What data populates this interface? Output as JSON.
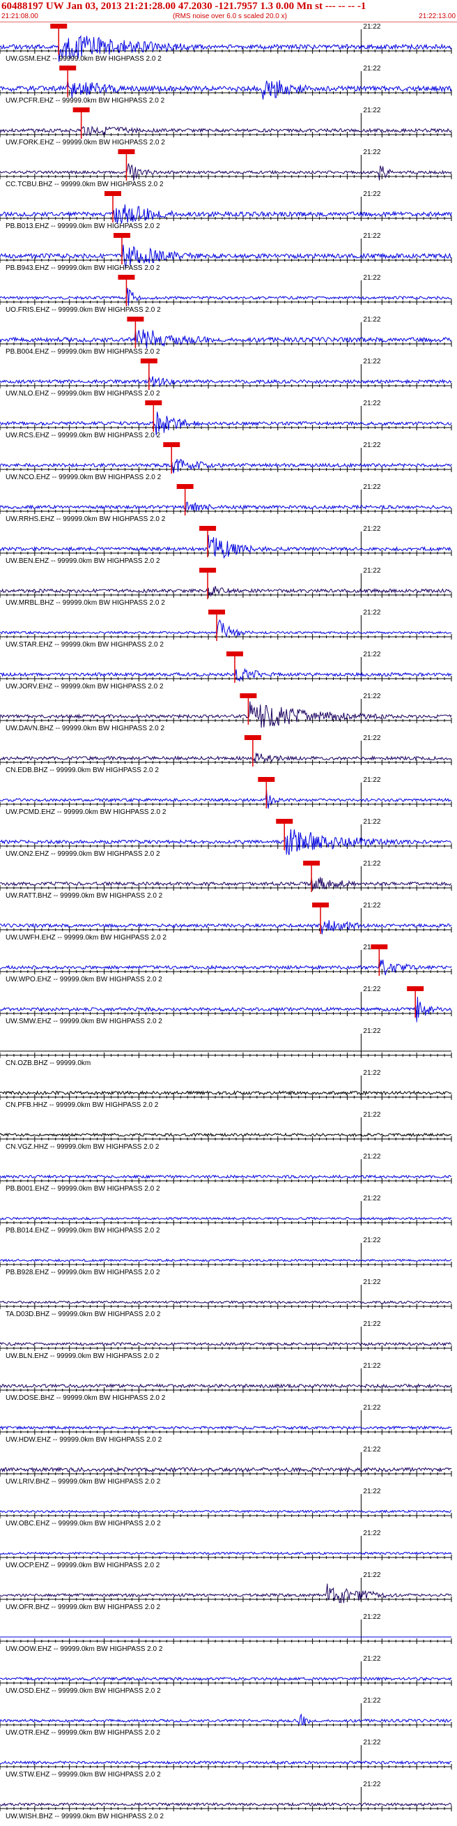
{
  "header": {
    "title": "60488197 UW Jan 03, 2013 21:21:28.00   47.2030 -121.7957  1.3 0.00 Mn st --- -- --  -1",
    "start_time": "21:21:08.00",
    "rms_note": "(RMS noise over 6.0 s scaled 20.0 x)",
    "end_time": "21:22:13.00"
  },
  "colors": {
    "header_red": "#d00000",
    "pick_red": "#e00000",
    "trace_blue": "#0000e0",
    "trace_navy": "#1a0060",
    "trace_black": "#000000",
    "axis_black": "#000000"
  },
  "chart_data": {
    "type": "seismogram",
    "x_axis": {
      "start": "21:21:08.00",
      "end": "21:22:13.00",
      "minute_tick_label": "21:22",
      "minute_tick_time": "21:22:00"
    },
    "traces": [
      {
        "label": "UW.GSM.EHZ -- 99999.0km BW  HIGHPASS  2.0  2",
        "pick_label": "",
        "pick": 0.13,
        "events": [
          [
            0.13,
            0.55,
            1.0
          ]
        ],
        "amp": 0.8,
        "seed": 1,
        "color": "blue"
      },
      {
        "label": "UW.PCFR.EHZ -- 99999.0km BW  HIGHPASS  2.0  2",
        "pick_label": "",
        "pick": 0.15,
        "events": [
          [
            0.15,
            0.3,
            0.7
          ],
          [
            0.58,
            0.2,
            1.0
          ]
        ],
        "amp": 0.9,
        "seed": 2,
        "color": "blue"
      },
      {
        "label": "UW.FORK.EHZ -- 99999.0km BW  HIGHPASS  2.0  2",
        "pick_label": "",
        "pick": 0.18,
        "events": [
          [
            0.18,
            0.4,
            0.4
          ]
        ],
        "amp": 0.6,
        "seed": 3,
        "color": "navy"
      },
      {
        "label": "CC.TCBU.BHZ -- 99999.0km BW  HIGHPASS  2.0  2",
        "pick_label": "",
        "pick": 0.28,
        "events": [
          [
            0.28,
            0.1,
            0.9
          ],
          [
            0.84,
            0.05,
            0.8
          ]
        ],
        "amp": 0.5,
        "seed": 4,
        "color": "navy"
      },
      {
        "label": "PB.B013.EHZ -- 99999.0km BW  HIGHPASS  2.0  2",
        "pick_label": "",
        "pick": 0.25,
        "events": [
          [
            0.25,
            0.3,
            0.9
          ]
        ],
        "amp": 0.8,
        "seed": 5,
        "color": "blue"
      },
      {
        "label": "PB.B943.EHZ -- 99999.0km BW  HIGHPASS  2.0  2",
        "pick_label": "",
        "pick": 0.27,
        "events": [
          [
            0.27,
            0.3,
            0.9
          ]
        ],
        "amp": 0.8,
        "seed": 6,
        "color": "blue"
      },
      {
        "label": "UO.FRIS.EHZ -- 99999.0km BW  HIGHPASS  2.0  2",
        "pick_label": "",
        "pick": 0.28,
        "events": [
          [
            0.28,
            0.05,
            0.9
          ]
        ],
        "amp": 0.5,
        "seed": 7,
        "color": "blue"
      },
      {
        "label": "PB.B004.EHZ -- 99999.0km BW  HIGHPASS  2.0  2",
        "pick_label": "",
        "pick": 0.3,
        "events": [
          [
            0.3,
            0.3,
            0.9
          ]
        ],
        "amp": 0.8,
        "seed": 8,
        "color": "blue"
      },
      {
        "label": "UW.NLO.EHZ -- 99999.0km BW  HIGHPASS  2.0  2",
        "pick_label": "",
        "pick": 0.33,
        "events": [
          [
            0.33,
            0.2,
            0.4
          ]
        ],
        "amp": 0.6,
        "seed": 9,
        "color": "blue"
      },
      {
        "label": "UW.RCS.EHZ -- 99999.0km BW  HIGHPASS  2.0  2",
        "pick_label": "",
        "pick": 0.34,
        "events": [
          [
            0.34,
            0.15,
            1.0
          ]
        ],
        "amp": 0.6,
        "seed": 10,
        "color": "blue"
      },
      {
        "label": "UW.NCO.EHZ -- 99999.0km BW  HIGHPASS  2.0  2",
        "pick_label": "",
        "pick": 0.38,
        "events": [
          [
            0.38,
            0.2,
            0.6
          ]
        ],
        "amp": 0.6,
        "seed": 11,
        "color": "blue"
      },
      {
        "label": "UW.RRHS.EHZ -- 99999.0km BW  HIGHPASS  2.0  2",
        "pick_label": "",
        "pick": 0.41,
        "events": [
          [
            0.41,
            0.2,
            0.4
          ]
        ],
        "amp": 0.6,
        "seed": 12,
        "color": "blue"
      },
      {
        "label": "UW.BEN.EHZ -- 99999.0km BW  HIGHPASS  2.0  2",
        "pick_label": "",
        "pick": 0.46,
        "events": [
          [
            0.46,
            0.2,
            1.0
          ]
        ],
        "amp": 0.6,
        "seed": 13,
        "color": "blue"
      },
      {
        "label": "UW.MRBL.BHZ -- 99999.0km BW  HIGHPASS  2.0  2",
        "pick_label": "",
        "pick": 0.46,
        "events": [
          [
            0.46,
            0.2,
            0.4
          ]
        ],
        "amp": 0.6,
        "seed": 14,
        "color": "navy"
      },
      {
        "label": "UW.STAR.EHZ -- 99999.0km BW  HIGHPASS  2.0  2",
        "pick_label": "",
        "pick": 0.48,
        "events": [
          [
            0.48,
            0.1,
            1.0
          ]
        ],
        "amp": 0.4,
        "seed": 15,
        "color": "blue"
      },
      {
        "label": "UW.JORV.EHZ -- 99999.0km BW  HIGHPASS  2.0  2",
        "pick_label": "",
        "pick": 0.52,
        "events": [
          [
            0.52,
            0.2,
            0.5
          ]
        ],
        "amp": 0.6,
        "seed": 16,
        "color": "blue"
      },
      {
        "label": "UW.DAVN.BHZ -- 99999.0km BW  HIGHPASS  2.0  2",
        "pick_label": "",
        "pick": 0.55,
        "events": [
          [
            0.55,
            0.45,
            1.0
          ]
        ],
        "amp": 0.6,
        "seed": 17,
        "color": "navy"
      },
      {
        "label": "CN.EDB.BHZ -- 99999.0km BW  HIGHPASS  2.0  2",
        "pick_label": "",
        "pick": 0.56,
        "events": [
          [
            0.56,
            0.2,
            0.4
          ]
        ],
        "amp": 0.6,
        "seed": 18,
        "color": "navy"
      },
      {
        "label": "UW.PCMD.EHZ -- 99999.0km BW  HIGHPASS  2.0  2",
        "pick_label": "",
        "pick": 0.59,
        "events": [
          [
            0.59,
            0.05,
            0.8
          ]
        ],
        "amp": 0.5,
        "seed": 19,
        "color": "blue"
      },
      {
        "label": "UW.ON2.EHZ -- 99999.0km BW  HIGHPASS  2.0  2",
        "pick_label": "",
        "pick": 0.63,
        "events": [
          [
            0.63,
            0.4,
            1.0
          ]
        ],
        "amp": 0.6,
        "seed": 20,
        "color": "blue"
      },
      {
        "label": "UW.RATT.BHZ -- 99999.0km BW  HIGHPASS  2.0  2",
        "pick_label": "",
        "pick": 0.69,
        "events": [
          [
            0.69,
            0.2,
            0.6
          ]
        ],
        "amp": 0.6,
        "seed": 21,
        "color": "navy"
      },
      {
        "label": "UW.UWFH.EHZ -- 99999.0km BW  HIGHPASS  2.0  2",
        "pick_label": "",
        "pick": 0.71,
        "events": [
          [
            0.71,
            0.2,
            0.6
          ]
        ],
        "amp": 0.6,
        "seed": 22,
        "color": "blue"
      },
      {
        "label": "UW.WPO.EHZ -- 99999.0km BW  HIGHPASS  2.0  2",
        "pick_label": "",
        "pick": 0.84,
        "events": [
          [
            0.84,
            0.15,
            0.7
          ]
        ],
        "amp": 0.6,
        "seed": 23,
        "color": "blue"
      },
      {
        "label": "UW.SMW.EHZ -- 99999.0km BW  HIGHPASS  2.0  2",
        "pick_label": "",
        "pick": 0.92,
        "events": [
          [
            0.92,
            0.08,
            1.0
          ]
        ],
        "amp": 0.6,
        "seed": 24,
        "color": "blue"
      },
      {
        "label": "CN.OZB.BHZ -- 99999.0km",
        "pick_label": "",
        "pick": null,
        "events": [],
        "amp": 0.0,
        "seed": 25,
        "color": "black"
      },
      {
        "label": "CN.PFB.HHZ -- 99999.0km BW  HIGHPASS  2.0  2",
        "pick_label": "",
        "pick": null,
        "events": [],
        "amp": 0.6,
        "seed": 26,
        "color": "black"
      },
      {
        "label": "CN.VGZ.HHZ -- 99999.0km BW  HIGHPASS  2.0  2",
        "pick_label": "",
        "pick": null,
        "events": [],
        "amp": 0.5,
        "seed": 27,
        "color": "black"
      },
      {
        "label": "PB.B001.EHZ -- 99999.0km BW  HIGHPASS  2.0  2",
        "pick_label": "",
        "pick": null,
        "events": [],
        "amp": 0.5,
        "seed": 28,
        "color": "blue"
      },
      {
        "label": "PB.B014.EHZ -- 99999.0km BW  HIGHPASS  2.0  2",
        "pick_label": "",
        "pick": null,
        "events": [],
        "amp": 0.4,
        "seed": 29,
        "color": "blue"
      },
      {
        "label": "PB.B928.EHZ -- 99999.0km BW  HIGHPASS  2.0  2",
        "pick_label": "",
        "pick": null,
        "events": [],
        "amp": 0.4,
        "seed": 30,
        "color": "blue"
      },
      {
        "label": "TA.D03D.BHZ -- 99999.0km BW  HIGHPASS  2.0  2",
        "pick_label": "",
        "pick": null,
        "events": [],
        "amp": 0.4,
        "seed": 31,
        "color": "navy"
      },
      {
        "label": "UW.BLN.EHZ -- 99999.0km BW  HIGHPASS  2.0  2",
        "pick_label": "",
        "pick": null,
        "events": [],
        "amp": 0.5,
        "seed": 32,
        "color": "navy"
      },
      {
        "label": "UW.DOSE.BHZ -- 99999.0km BW  HIGHPASS  2.0  2",
        "pick_label": "",
        "pick": null,
        "events": [],
        "amp": 0.6,
        "seed": 33,
        "color": "navy"
      },
      {
        "label": "UW.HDW.EHZ -- 99999.0km BW  HIGHPASS  2.0  2",
        "pick_label": "",
        "pick": null,
        "events": [],
        "amp": 0.5,
        "seed": 34,
        "color": "blue"
      },
      {
        "label": "UW.LRIV.BHZ -- 99999.0km BW  HIGHPASS  2.0  2",
        "pick_label": "",
        "pick": null,
        "events": [],
        "amp": 0.7,
        "seed": 35,
        "color": "navy"
      },
      {
        "label": "UW.OBC.EHZ -- 99999.0km BW  HIGHPASS  2.0  2",
        "pick_label": "",
        "pick": null,
        "events": [],
        "amp": 0.4,
        "seed": 36,
        "color": "blue"
      },
      {
        "label": "UW.OCP.EHZ -- 99999.0km BW  HIGHPASS  2.0  2",
        "pick_label": "",
        "pick": null,
        "events": [],
        "amp": 0.4,
        "seed": 37,
        "color": "blue"
      },
      {
        "label": "UW.OFR.BHZ -- 99999.0km BW  HIGHPASS  2.0  2",
        "pick_label": "",
        "pick": null,
        "events": [
          [
            0.72,
            0.22,
            1.0
          ]
        ],
        "amp": 0.5,
        "seed": 38,
        "color": "navy"
      },
      {
        "label": "UW.OOW.EHZ -- 99999.0km BW  HIGHPASS  2.0  2",
        "pick_label": "",
        "pick": null,
        "events": [],
        "amp": 0.0,
        "seed": 39,
        "color": "blue"
      },
      {
        "label": "UW.OSD.EHZ -- 99999.0km BW  HIGHPASS  2.0  2",
        "pick_label": "",
        "pick": null,
        "events": [],
        "amp": 0.5,
        "seed": 40,
        "color": "blue"
      },
      {
        "label": "UW.OTR.EHZ -- 99999.0km BW  HIGHPASS  2.0  2",
        "pick_label": "",
        "pick": null,
        "events": [
          [
            0.66,
            0.06,
            0.6
          ]
        ],
        "amp": 0.5,
        "seed": 41,
        "color": "blue"
      },
      {
        "label": "UW.STW.EHZ -- 99999.0km BW  HIGHPASS  2.0  2",
        "pick_label": "",
        "pick": null,
        "events": [],
        "amp": 0.5,
        "seed": 42,
        "color": "blue"
      },
      {
        "label": "UW.WISH.BHZ -- 99999.0km BW  HIGHPASS  2.0  2",
        "pick_label": "",
        "pick": null,
        "events": [],
        "amp": 0.5,
        "seed": 43,
        "color": "navy"
      }
    ]
  }
}
